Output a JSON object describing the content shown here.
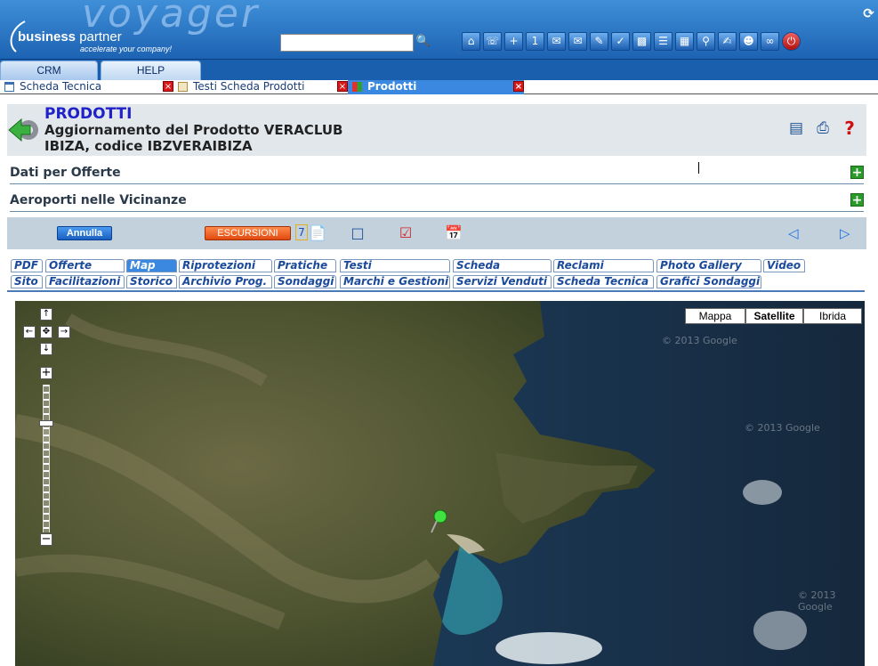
{
  "brand": {
    "name_bold": "business",
    "name_light": " partner",
    "slogan": "accelerate your company!",
    "product": "voyager"
  },
  "search": {
    "placeholder": ""
  },
  "menu_tabs": [
    "CRM",
    "HELP"
  ],
  "doc_tabs": [
    {
      "label": "Scheda Tecnica",
      "active": false
    },
    {
      "label": "Testi Scheda Prodotti",
      "active": false
    },
    {
      "label": "Prodotti",
      "active": true
    }
  ],
  "header": {
    "title": "PRODOTTI",
    "subtitle": "Aggiornamento del Prodotto VERACLUB IBIZA, codice IBZVERAIBIZA"
  },
  "sections": [
    "Dati per Offerte",
    "Aeroporti nelle Vicinanze"
  ],
  "toolbar": {
    "cancel": "Annulla",
    "excursions": "ESCURSIONI",
    "badge": "7"
  },
  "product_tabs_row1": [
    "PDF",
    "Offerte",
    "Map",
    "Riprotezioni",
    "Pratiche",
    "Testi",
    "Scheda",
    "Reclami",
    "Photo Gallery",
    "Video"
  ],
  "product_tabs_row2": [
    "Sito",
    "Facilitazioni",
    "Storico",
    "Archivio Prog.",
    "Sondaggi",
    "Marchi e Gestioni",
    "Servizi Venduti",
    "Scheda Tecnica",
    "Grafici Sondaggi"
  ],
  "active_tab": "Map",
  "map": {
    "types": [
      "Mappa",
      "Satellite",
      "Ibrida"
    ],
    "selected": "Satellite",
    "copyright": "© 2013 Google",
    "zoom_level": 0.25
  },
  "colors": {
    "accent": "#1f22c8",
    "topbar": "#1d63b3",
    "active_tab": "#3a88e0",
    "add": "#2a9a2a"
  }
}
